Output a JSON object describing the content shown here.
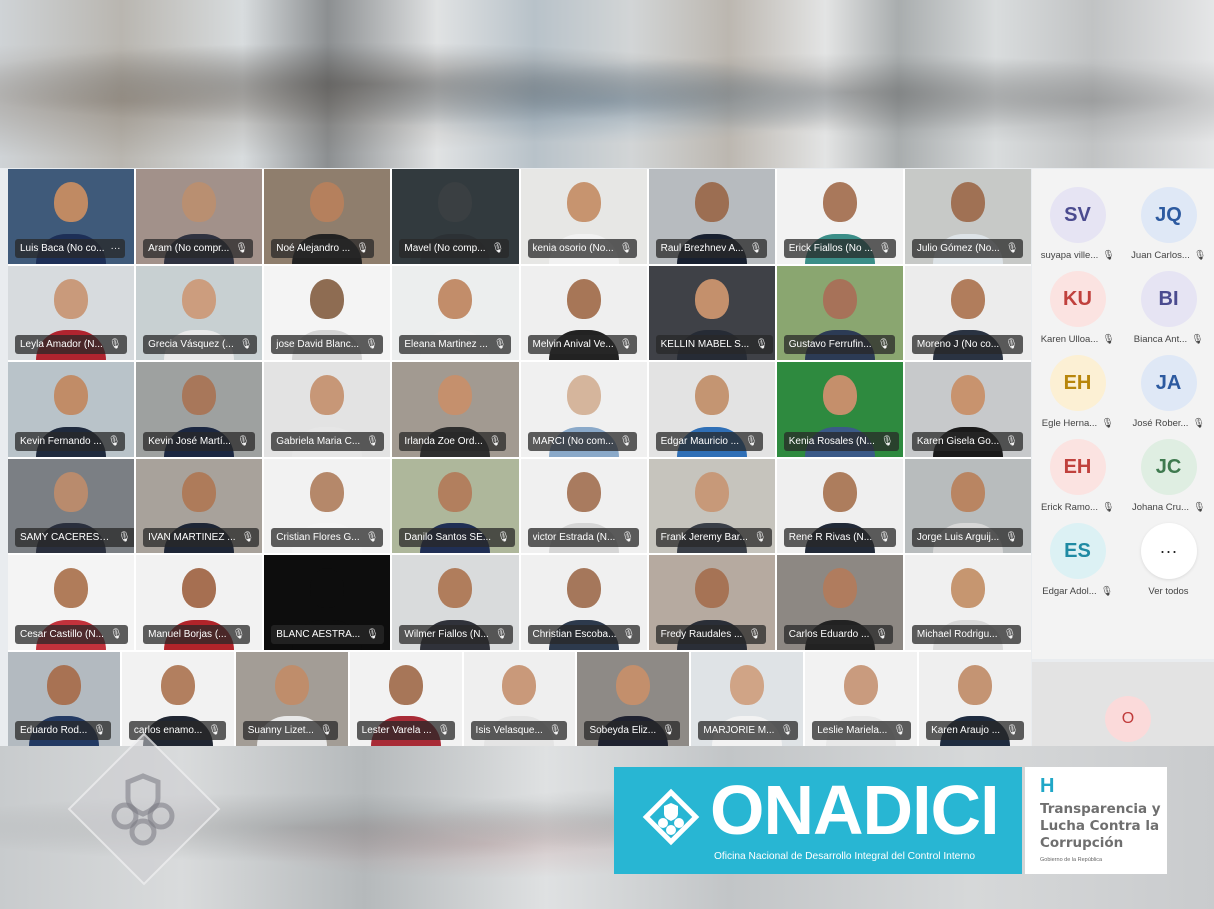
{
  "tiles": [
    {
      "name": "Luis Baca (No co...",
      "extra": "···",
      "bg": "#3f5a7a",
      "face": "#c08a63",
      "shirt": "#1d2f57"
    },
    {
      "name": "Aram (No compr...",
      "bg": "#a2918a",
      "face": "#b98f71",
      "shirt": "#2f3240"
    },
    {
      "name": "Noé Alejandro ...",
      "bg": "#8f7e6d",
      "face": "#b5805d",
      "shirt": "#222"
    },
    {
      "name": "Mavel (No comp...",
      "bg": "#323a3e",
      "face": "#3a3f42",
      "shirt": "#2c3135"
    },
    {
      "name": "kenia osorio (No...",
      "bg": "#e7e7e5",
      "face": "#c7946f",
      "shirt": "#f1f1f1"
    },
    {
      "name": "Raul Brezhnev A...",
      "bg": "#b7bbbf",
      "face": "#9c6e52",
      "shirt": "#182030"
    },
    {
      "name": "Erick Fiallos (No ...",
      "bg": "#f2f2f2",
      "face": "#a9785b",
      "shirt": "#3b8e88"
    },
    {
      "name": "Julio Gómez (No...",
      "bg": "#c7c9c7",
      "face": "#a07154",
      "shirt": "#dde3e7"
    },
    {
      "name": "Leyla Amador (N...",
      "bg": "#d7dbde",
      "face": "#c99a7b",
      "shirt": "#b0242f"
    },
    {
      "name": "Grecia Vásquez (...",
      "bg": "#c8d0d2",
      "face": "#cc9d7e",
      "shirt": "#e9e9e9"
    },
    {
      "name": "jose David Blanc...",
      "bg": "#f4f4f4",
      "face": "#8e6c52",
      "shirt": "#d5d5d5"
    },
    {
      "name": "Eleana Martinez ...",
      "bg": "#eceeee",
      "face": "#c28d6a",
      "shirt": "#f0f0f0"
    },
    {
      "name": "Melvin Anival Ve...",
      "bg": "#efefef",
      "face": "#a77657",
      "shirt": "#222"
    },
    {
      "name": "KELLIN MABEL S...",
      "bg": "#3f4147",
      "face": "#c4906c",
      "shirt": "#262b35"
    },
    {
      "name": "Gustavo Ferrufin...",
      "bg": "#8aa670",
      "face": "#a77259",
      "shirt": "#2c3b55"
    },
    {
      "name": "Moreno J (No co...",
      "bg": "#ececec",
      "face": "#b17d5c",
      "shirt": "#2a3342"
    },
    {
      "name": "Kevin Fernando ...",
      "bg": "#b9c3c9",
      "face": "#c18c67",
      "shirt": "#1f2a3d"
    },
    {
      "name": "Kevin José Martí...",
      "bg": "#9ea1a0",
      "face": "#a8775a",
      "shirt": "#1b2741"
    },
    {
      "name": "Gabriela Maria C...",
      "bg": "#e3e3e3",
      "face": "#c79777",
      "shirt": "#e6e6e6"
    },
    {
      "name": "Irlanda Zoe Ord...",
      "bg": "#a29a91",
      "face": "#c5906d",
      "shirt": "#2e2e2e"
    },
    {
      "name": "MARCI (No com...",
      "bg": "#f0f0f0",
      "face": "#d5b59c",
      "shirt": "#8aa9c9"
    },
    {
      "name": "Edgar Mauricio ...",
      "bg": "#e3e3e3",
      "face": "#c49572",
      "shirt": "#2f6fb6"
    },
    {
      "name": "Kenia Rosales (N...",
      "bg": "#2e8a3f",
      "face": "#c58f6b",
      "shirt": "#3b5a88"
    },
    {
      "name": "Karen Gisela Go...",
      "bg": "#c7c9cb",
      "face": "#c8936e",
      "shirt": "#1a1a1a"
    },
    {
      "name": "SAMY CACERES (...",
      "bg": "#7b7f84",
      "face": "#b98b6d",
      "shirt": "#2a2f3d"
    },
    {
      "name": "IVAN MARTINEZ ...",
      "bg": "#a8a29b",
      "face": "#ae7b5a",
      "shirt": "#1e2636"
    },
    {
      "name": "Cristian Flores G...",
      "bg": "#f2f2f2",
      "face": "#b5886a",
      "shirt": "#f4f4f4"
    },
    {
      "name": "Danilo Santos SE...",
      "bg": "#aeb79b",
      "face": "#b27f5e",
      "shirt": "#202f55"
    },
    {
      "name": "victor Estrada (N...",
      "bg": "#f0f0f0",
      "face": "#a97b5f",
      "shirt": "#d6d6d6"
    },
    {
      "name": "Frank Jeremy Bar...",
      "bg": "#c6c4bd",
      "face": "#c79979",
      "shirt": "#3a3f48"
    },
    {
      "name": "Rene R Rivas (N...",
      "bg": "#efefef",
      "face": "#ad7d5d",
      "shirt": "#222a38"
    },
    {
      "name": "Jorge Luis Arguij...",
      "bg": "#b8bcbd",
      "face": "#b98562",
      "shirt": "#d7d7d7"
    },
    {
      "name": "Cesar Castillo (N...",
      "bg": "#f4f4f4",
      "face": "#b07c5a",
      "shirt": "#c2323c"
    },
    {
      "name": "Manuel Borjas (...",
      "bg": "#f2f2f2",
      "face": "#a66f51",
      "shirt": "#b1242a"
    },
    {
      "name": "BLANC AESTRA...",
      "bg": "#0d0d0d",
      "face": "#0d0d0d",
      "shirt": "#0d0d0d"
    },
    {
      "name": "Wilmer Fiallos (N...",
      "bg": "#d9dbdc",
      "face": "#b07d5c",
      "shirt": "#30323a"
    },
    {
      "name": "Christian Escoba...",
      "bg": "#f0f0f0",
      "face": "#a5775b",
      "shirt": "#2d3a4d"
    },
    {
      "name": "Fredy Raudales ...",
      "bg": "#b6aaa0",
      "face": "#a67355",
      "shirt": "#2a2e37"
    },
    {
      "name": "Carlos Eduardo ...",
      "bg": "#8d8883",
      "face": "#b07c5e",
      "shirt": "#222"
    },
    {
      "name": "Michael Rodrigu...",
      "bg": "#f0f0f0",
      "face": "#c69670",
      "shirt": "#d9d9d9"
    }
  ],
  "last_row": [
    {
      "name": "Eduardo Rod...",
      "bg": "#b3bac0",
      "face": "#a87253",
      "shirt": "#233a63"
    },
    {
      "name": "carlos enamo...",
      "bg": "#f2f2f2",
      "face": "#b27f5f",
      "shirt": "#202632"
    },
    {
      "name": "Suanny Lizet...",
      "bg": "#a39d96",
      "face": "#bf8d6b",
      "shirt": "#e8e8e8"
    },
    {
      "name": "Lester Varela ...",
      "bg": "#f2f2f2",
      "face": "#a77658",
      "shirt": "#a82b36"
    },
    {
      "name": "Isis Velasque...",
      "bg": "#efefef",
      "face": "#c9997a",
      "shirt": "#e4e4e4"
    },
    {
      "name": "Sobeyda Eliz...",
      "bg": "#8e8a86",
      "face": "#c38f6c",
      "shirt": "#1f2230"
    },
    {
      "name": "MARJORIE M...",
      "bg": "#dfe3e6",
      "face": "#d0a486",
      "shirt": "#f2f2f2"
    },
    {
      "name": "Leslie Mariela...",
      "bg": "#f2f2f2",
      "face": "#c99b7e",
      "shirt": "#e8e8e8"
    },
    {
      "name": "Karen Araujo ...",
      "bg": "#efefef",
      "face": "#c49473",
      "shirt": "#1e2b3f"
    }
  ],
  "sidebar": {
    "people": [
      {
        "initials": "SV",
        "name": "suyapa ville...",
        "bg": "#e6e4f3",
        "fg": "#4b4b8f"
      },
      {
        "initials": "JQ",
        "name": "Juan Carlos...",
        "bg": "#dfe8f6",
        "fg": "#2d5aa0"
      },
      {
        "initials": "KU",
        "name": "Karen Ulloa...",
        "bg": "#fbe3e1",
        "fg": "#c0413d"
      },
      {
        "initials": "BI",
        "name": "Bianca Ant...",
        "bg": "#e6e4f3",
        "fg": "#4b4b8f"
      },
      {
        "initials": "EH",
        "name": "Egle Herna...",
        "bg": "#fcf0d4",
        "fg": "#b8860b"
      },
      {
        "initials": "JA",
        "name": "José Rober...",
        "bg": "#dfe8f6",
        "fg": "#2d5aa0"
      },
      {
        "initials": "EH",
        "name": "Erick Ramo...",
        "bg": "#fbe3e1",
        "fg": "#c0413d"
      },
      {
        "initials": "JC",
        "name": "Johana Cru...",
        "bg": "#dfeee2",
        "fg": "#3f7a4f"
      },
      {
        "initials": "ES",
        "name": "Edgar Adol...",
        "bg": "#dcf1f4",
        "fg": "#1f8aa3"
      }
    ],
    "more_label": "Ver todos",
    "more_icon": "···",
    "self_initial": "O"
  },
  "mic_icon": "🎙",
  "logos": {
    "onadici_title": "ONADICI",
    "onadici_subtitle": "Oficina Nacional de Desarrollo Integral del Control Interno",
    "trans_h": "H",
    "trans_text": "Transparencia y Lucha Contra la Corrupción",
    "trans_gov": "Gobierno de la República"
  }
}
